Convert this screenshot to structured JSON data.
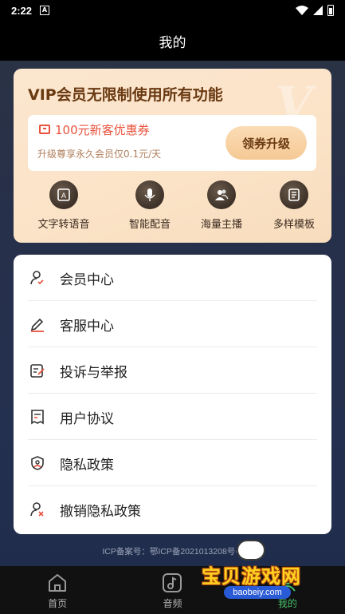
{
  "status_bar": {
    "time": "2:22",
    "notif_icon": "A"
  },
  "header": {
    "title": "我的"
  },
  "vip": {
    "watermark": "V",
    "title": "VIP会员无限制使用所有功能",
    "coupon": {
      "title": "100元新客优惠券",
      "subtitle": "升级尊享永久会员仅0.1元/天",
      "button": "领券升级"
    },
    "features": [
      {
        "label": "文字转语音",
        "icon": "text-to-speech-icon"
      },
      {
        "label": "智能配音",
        "icon": "microphone-icon"
      },
      {
        "label": "海量主播",
        "icon": "anchors-icon"
      },
      {
        "label": "多样模板",
        "icon": "template-icon"
      }
    ]
  },
  "menu": {
    "items": [
      {
        "label": "会员中心",
        "icon": "member-icon"
      },
      {
        "label": "客服中心",
        "icon": "pencil-icon"
      },
      {
        "label": "投诉与举报",
        "icon": "report-icon"
      },
      {
        "label": "用户协议",
        "icon": "agreement-icon"
      },
      {
        "label": "隐私政策",
        "icon": "privacy-icon"
      },
      {
        "label": "撤销隐私政策",
        "icon": "revoke-icon"
      }
    ]
  },
  "icp": "ICP备案号：鄂ICP备2021013208号-4",
  "tabs": [
    {
      "label": "首页",
      "icon": "home-icon"
    },
    {
      "label": "音频",
      "icon": "music-icon"
    },
    {
      "label": "我的",
      "icon": "profile-icon"
    }
  ],
  "watermark_logo": {
    "text": "宝贝游戏网",
    "url": "baobeiy.com"
  },
  "colors": {
    "accent_green": "#46c06a",
    "vip_brown": "#6a3a12",
    "coupon_red": "#e8523c"
  }
}
